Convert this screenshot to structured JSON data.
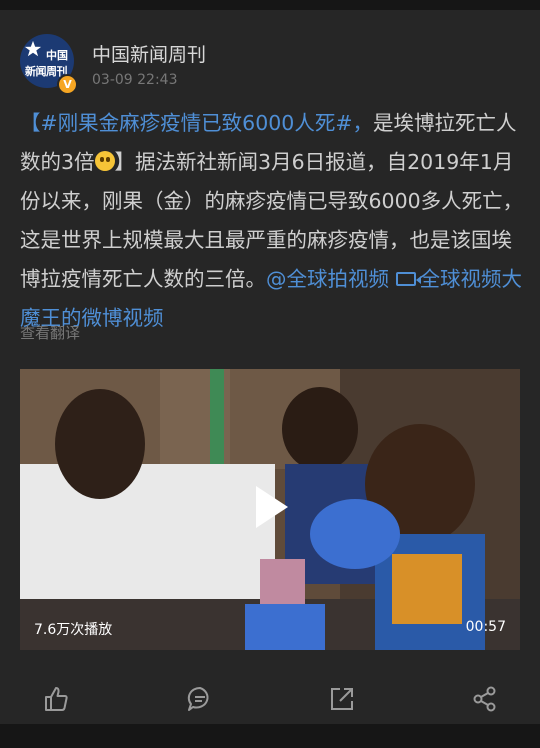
{
  "post": {
    "author": "中国新闻周刊",
    "avatar_line1": "中国",
    "avatar_line2": "新闻周刊",
    "timestamp": "03-09 22:43",
    "hashtag": "【#刚果金麻疹疫情已致6000人死#，",
    "text_after_hashtag": "是埃博拉死亡人数的3倍",
    "body": "】据法新社新闻3月6日报道，自2019年1月份以来，刚果（金）的麻疹疫情已导致6000多人死亡，这是世界上规模最大且最严重的麻疹疫情，也是该国埃博拉疫情死亡人数的三倍。",
    "mention": "@全球拍视频",
    "video_link": "全球视频大魔王的微博视频",
    "translate": "查看翻译"
  },
  "video": {
    "views": "7.6万次播放",
    "duration": "00:57"
  },
  "icons": [
    "thumb-up-icon",
    "comment-icon",
    "repost-icon",
    "share-icon"
  ],
  "colors": {
    "link": "#4f8fd6",
    "background": "#262626",
    "text": "#cfcfcf"
  }
}
